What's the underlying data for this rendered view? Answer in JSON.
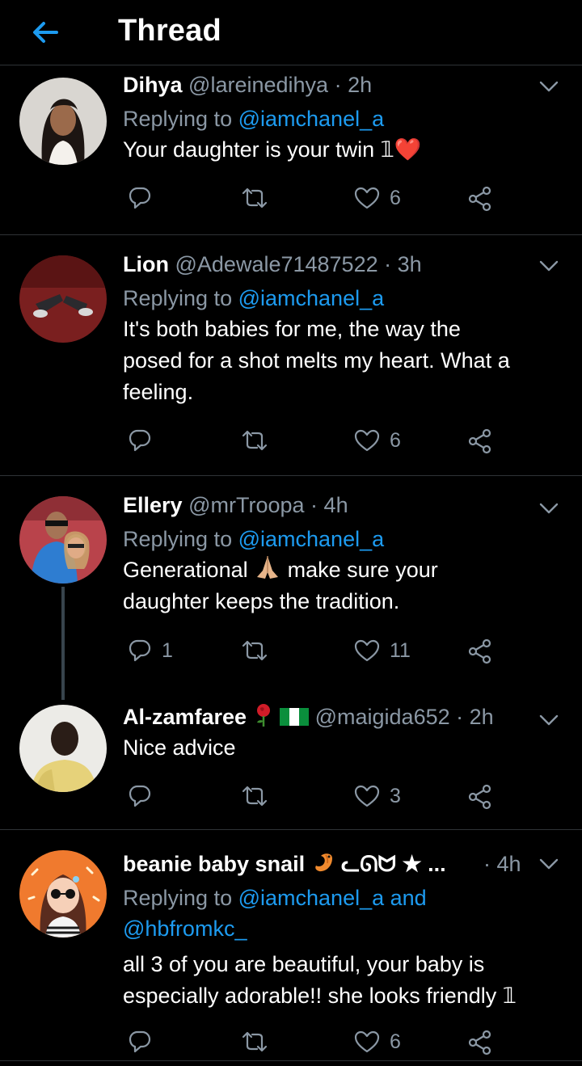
{
  "header": {
    "title": "Thread",
    "back_icon": "arrow-left-icon"
  },
  "tweets": [
    {
      "name": "Dihya",
      "handle": "@lareinedihya",
      "time": "2h",
      "reply_prefix": "Replying to",
      "reply_to": "@iamchanel_a",
      "text": "Your daughter is your twin 𝟙❤️",
      "replies": "",
      "likes": "6"
    },
    {
      "name": "Lion",
      "handle": "@Adewale71487522",
      "time": "3h",
      "reply_prefix": "Replying to",
      "reply_to": "@iamchanel_a",
      "text_lines": [
        "It's both babies for me, the way the",
        "posed for a shot melts my heart. What a",
        "feeling."
      ],
      "replies": "",
      "likes": "6"
    },
    {
      "name": "Ellery",
      "handle": "@mrTroopa",
      "time": "4h",
      "reply_prefix": "Replying to",
      "reply_to": "@iamchanel_a",
      "text_lines": [
        "Generational 🙏🏼 make sure your",
        "daughter keeps the tradition."
      ],
      "text_a": "Generational",
      "text_b": "make sure your",
      "text_line2": "daughter keeps the tradition.",
      "replies": "1",
      "likes": "11"
    },
    {
      "name": "Al-zamfaree",
      "handle": "@maigida652",
      "time": "2h",
      "text": "Nice advice",
      "replies": "",
      "likes": "3"
    },
    {
      "name": "beanie baby snail",
      "name_suffix": "ᓚᘏᗢ ★ ...",
      "time": "4h",
      "reply_prefix": "Replying to",
      "reply_to": "@iamchanel_a and",
      "reply_to_2": "@hbfromkc_",
      "text_lines": [
        "all 3 of you are beautiful, your baby is",
        "especially adorable!! she looks friendly 𝟙"
      ],
      "replies": "",
      "likes": "6"
    }
  ],
  "dot": "·",
  "icons": {
    "reply": "reply-icon",
    "retweet": "retweet-icon",
    "like": "heart-icon",
    "share": "share-icon",
    "more": "chevron-down-icon"
  },
  "colors": {
    "background": "#000000",
    "muted": "#8b98a5",
    "accent": "#1d9bf0",
    "divider": "#2f3336"
  }
}
